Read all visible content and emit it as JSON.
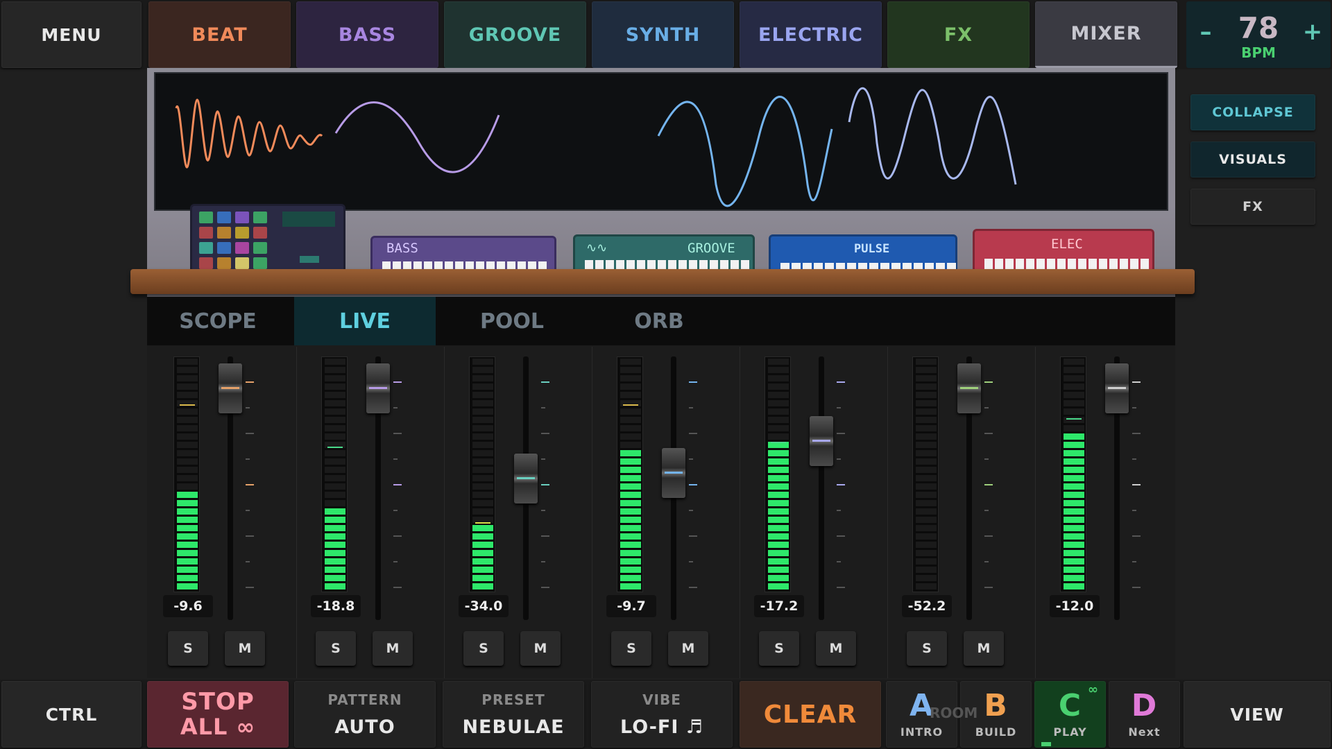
{
  "top": {
    "menu": "MENU",
    "tabs": [
      {
        "label": "BEAT",
        "color": "#f08a5a",
        "bg": "#3b2620"
      },
      {
        "label": "BASS",
        "color": "#a886e0",
        "bg": "#2d2440"
      },
      {
        "label": "GROOVE",
        "color": "#5fc7b4",
        "bg": "#1f3330"
      },
      {
        "label": "SYNTH",
        "color": "#69aee6",
        "bg": "#1f2c3e"
      },
      {
        "label": "ELECTRIC",
        "color": "#9aa5f0",
        "bg": "#262a44"
      },
      {
        "label": "FX",
        "color": "#7cc06a",
        "bg": "#22361f"
      },
      {
        "label": "MIXER",
        "color": "#c7c7cf",
        "bg": "#3a3a42"
      }
    ],
    "bpm": {
      "value": "78",
      "unit": "BPM",
      "minus": "–",
      "plus": "+"
    }
  },
  "side": {
    "collapse": "COLLAPSE",
    "visuals": "VISUALS",
    "fx": "FX"
  },
  "instruments": {
    "bass_label": "BASS",
    "groove_label": "GROOVE",
    "pulse_label": "PULSE",
    "elec_label": "ELEC"
  },
  "mixer": {
    "tabs": [
      "SCOPE",
      "LIVE",
      "POOL",
      "ORB"
    ],
    "active_tab": "LIVE",
    "channels": [
      {
        "db": "-9.6",
        "level": 0.42,
        "peak": 0.8,
        "peak_color": "#d9b84a",
        "fader": 0.92,
        "accent": "#e6a26a",
        "solo": "S",
        "mute": "M"
      },
      {
        "db": "-18.8",
        "level": 0.37,
        "peak": 0.62,
        "peak_color": "#4ad98a",
        "fader": 0.92,
        "accent": "#b79be6",
        "solo": "S",
        "mute": "M"
      },
      {
        "db": "-34.0",
        "level": 0.28,
        "peak": 0.3,
        "peak_color": "#d9e04a",
        "fader": 0.58,
        "accent": "#6ad0c0",
        "solo": "S",
        "mute": "M"
      },
      {
        "db": "-9.7",
        "level": 0.6,
        "peak": 0.8,
        "peak_color": "#d9b84a",
        "fader": 0.6,
        "accent": "#74b4ee",
        "solo": "S",
        "mute": "M"
      },
      {
        "db": "-17.2",
        "level": 0.64,
        "peak": 0.64,
        "peak_color": "#4ad98a",
        "fader": 0.72,
        "accent": "#a8a8ee",
        "solo": "S",
        "mute": "M"
      },
      {
        "db": "-52.2",
        "level": 0.0,
        "peak": 0.0,
        "peak_color": "#4ad98a",
        "fader": 0.92,
        "accent": "#9fd07c",
        "solo": "S",
        "mute": "M"
      },
      {
        "db": "-12.0",
        "level": 0.69,
        "peak": 0.74,
        "peak_color": "#4ad98a",
        "fader": 0.92,
        "accent": "#cfcfcf"
      }
    ]
  },
  "bottom": {
    "ctrl": "CTRL",
    "stop": "STOP",
    "stop_all": "ALL ∞",
    "pattern_label": "PATTERN",
    "pattern_value": "AUTO",
    "preset_label": "PRESET",
    "preset_value": "NEBULAE",
    "vibe_label": "VIBE",
    "vibe_value": "LO-FI ♬",
    "clear": "CLEAR",
    "scenes": [
      {
        "letter": "A",
        "label": "INTRO",
        "color": "#7fb4f0"
      },
      {
        "letter": "B",
        "label": "BUILD",
        "color": "#f0a050"
      },
      {
        "letter": "C",
        "label": "PLAY",
        "color": "#4ad070"
      },
      {
        "letter": "D",
        "label": "Next",
        "color": "#e07ad8"
      }
    ],
    "scene_overlay": "ROOM",
    "view": "VIEW"
  }
}
